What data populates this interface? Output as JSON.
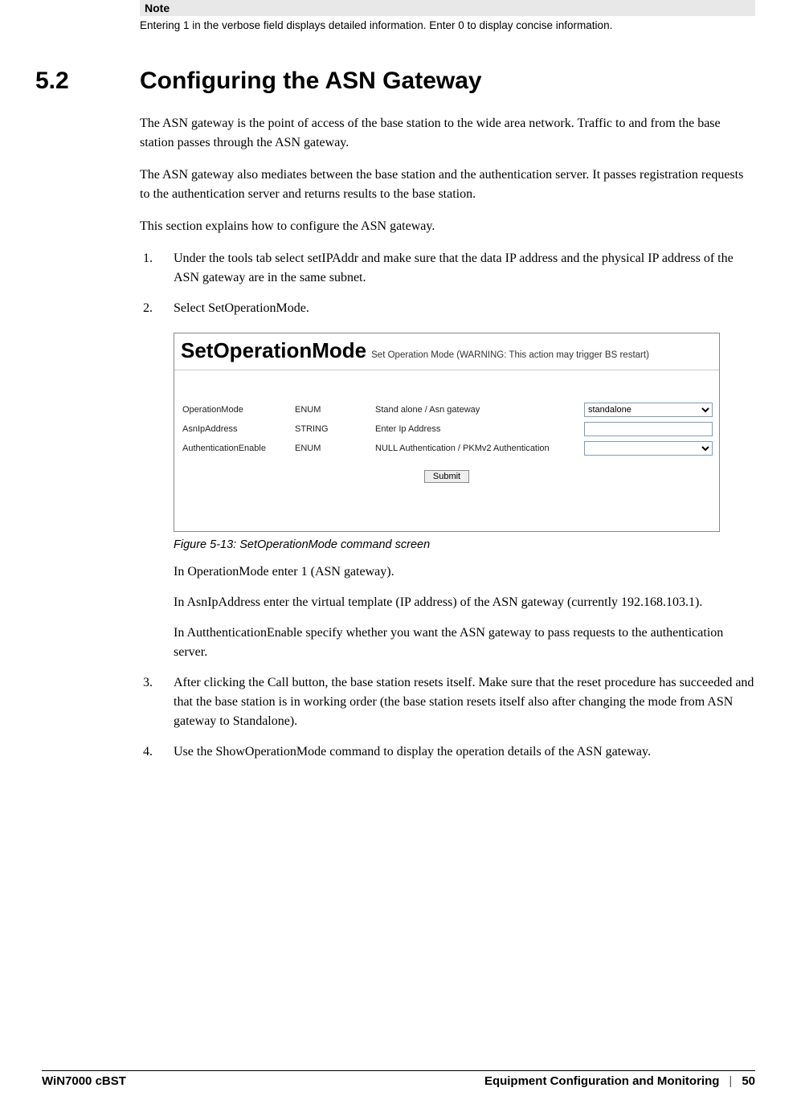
{
  "note": {
    "heading": "Note",
    "body": "Entering 1 in the verbose field displays detailed information. Enter 0 to display concise information."
  },
  "section": {
    "number": "5.2",
    "title": "Configuring the ASN Gateway"
  },
  "paragraphs": {
    "p1": "The ASN gateway is the point of access of the base station to the wide area network. Traffic to and from the base station passes through the ASN gateway.",
    "p2": "The ASN gateway also mediates between the base station and the authentication server. It passes registration requests to the authentication server and returns results to the base station.",
    "p3": "This section explains how to configure the ASN gateway."
  },
  "steps": {
    "s1": "Under the tools tab select setIPAddr and make sure that the data IP address and the physical IP address of the ASN gateway are in the same subnet.",
    "s2": "Select SetOperationMode.",
    "s3": "After clicking the Call button, the base station resets itself. Make sure that the reset procedure has succeeded and that the base station is in working order (the base station resets itself also after changing the mode from ASN gateway to Standalone).",
    "s4": "Use the ShowOperationMode command to display the operation details of the ASN gateway."
  },
  "screenshot": {
    "bigtitle": "SetOperationMode",
    "subtitle": "Set Operation Mode (WARNING: This action may trigger BS restart)",
    "rows": [
      {
        "name": "OperationMode",
        "type": "ENUM",
        "desc": "Stand alone / Asn gateway",
        "ctrl": "select",
        "value": "standalone"
      },
      {
        "name": "AsnIpAddress",
        "type": "STRING",
        "desc": "Enter Ip Address",
        "ctrl": "input",
        "value": ""
      },
      {
        "name": "AuthenticationEnable",
        "type": "ENUM",
        "desc": "NULL Authentication / PKMv2 Authentication",
        "ctrl": "select",
        "value": ""
      }
    ],
    "submit_label": "Submit"
  },
  "figure_caption": "Figure 5-13: SetOperationMode command screen",
  "after_fig": {
    "a1": "In OperationMode enter 1 (ASN gateway).",
    "a2": "In AsnIpAddress enter the virtual template (IP address) of the ASN gateway (currently 192.168.103.1).",
    "a3": "In AutthenticationEnable specify whether you want the ASN gateway to pass requests to the authentication server."
  },
  "footer": {
    "left": "WiN7000 cBST",
    "chapter": "Equipment Configuration and Monitoring",
    "sep": "|",
    "page": "50"
  }
}
